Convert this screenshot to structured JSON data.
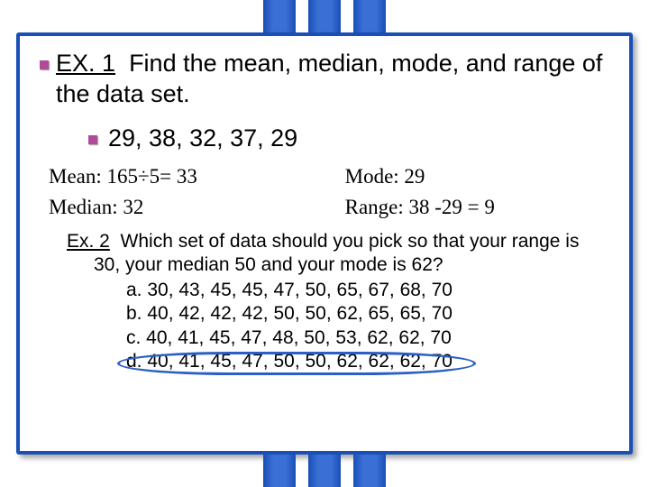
{
  "ex1": {
    "lead": "EX. 1",
    "text": "Find the mean, median, mode, and range of the data set."
  },
  "dataset": "29, 38, 32, 37, 29",
  "stats": {
    "mean": "Mean:  165÷5= 33",
    "mode": "Mode:  29",
    "median": "Median:  32",
    "range": "Range:  38 -29 = 9"
  },
  "ex2": {
    "lead": "Ex. 2",
    "text": "Which set of data should you pick so that your range is 30, your median 50 and your mode is 62?",
    "a": "a.  30, 43, 45, 45, 47, 50, 65, 67, 68, 70",
    "b": "b.  40, 42, 42, 42, 50, 50, 62, 65, 65, 70",
    "c": "c.  40, 41, 45, 47, 48, 50, 53, 62, 62, 70",
    "d": "d.  40, 41, 45, 47, 50, 50, 62, 62, 62, 70"
  }
}
